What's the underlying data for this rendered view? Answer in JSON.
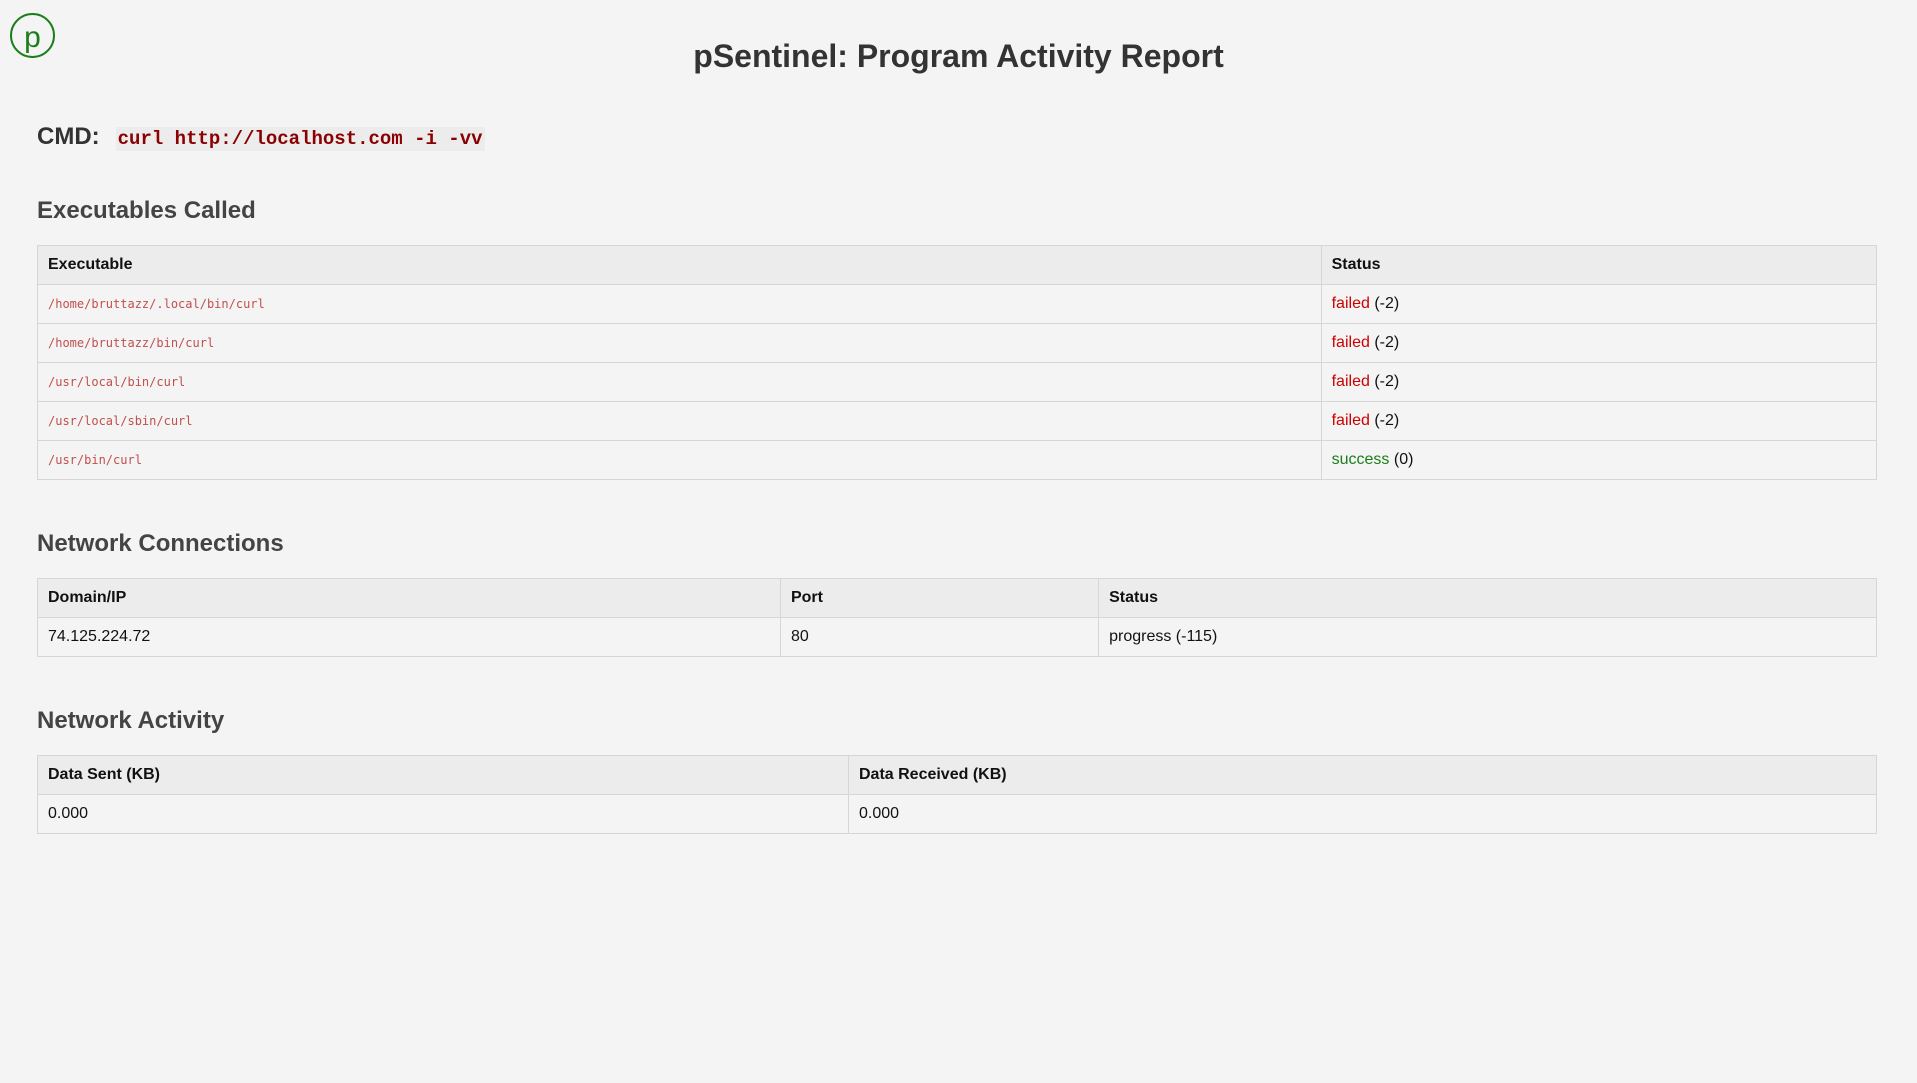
{
  "app": {
    "logo_letter": "p",
    "title": "pSentinel: Program Activity Report"
  },
  "cmd": {
    "label": "CMD:",
    "command": "curl http://localhost.com -i -vv"
  },
  "executables": {
    "heading": "Executables Called",
    "columns": [
      "Executable",
      "Status"
    ],
    "rows": [
      {
        "path": "/home/bruttazz/.local/bin/curl",
        "status": "failed",
        "code": "(-2)"
      },
      {
        "path": "/home/bruttazz/bin/curl",
        "status": "failed",
        "code": "(-2)"
      },
      {
        "path": "/usr/local/bin/curl",
        "status": "failed",
        "code": "(-2)"
      },
      {
        "path": "/usr/local/sbin/curl",
        "status": "failed",
        "code": "(-2)"
      },
      {
        "path": "/usr/bin/curl",
        "status": "success",
        "code": "(0)"
      }
    ]
  },
  "network_connections": {
    "heading": "Network Connections",
    "columns": [
      "Domain/IP",
      "Port",
      "Status"
    ],
    "rows": [
      {
        "domain": "74.125.224.72",
        "port": "80",
        "status": "progress (-115)"
      }
    ]
  },
  "network_activity": {
    "heading": "Network Activity",
    "columns": [
      "Data Sent (KB)",
      "Data Received (KB)"
    ],
    "rows": [
      {
        "sent": "0.000",
        "received": "0.000"
      }
    ]
  },
  "colors": {
    "failed": "#cc0000",
    "success": "#1a7f1a",
    "command": "#8b0000",
    "path": "#c0504d",
    "logo": "#1a7f1a"
  }
}
